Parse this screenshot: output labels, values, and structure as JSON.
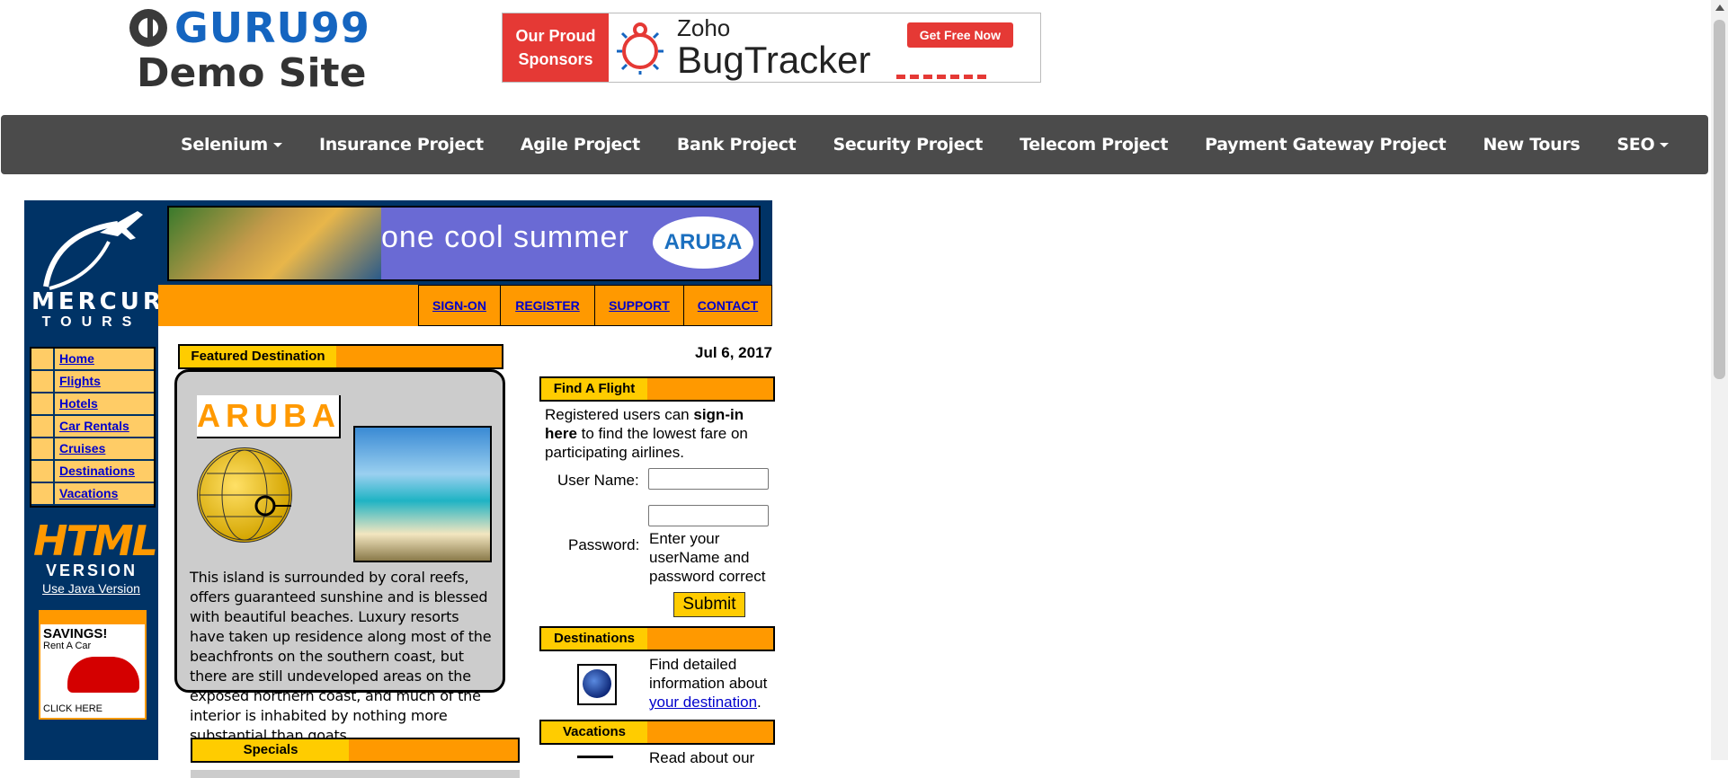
{
  "header": {
    "logo_text": "GURU99",
    "subtitle": "Demo Site",
    "sponsor": {
      "left_line1": "Our Proud",
      "left_line2": "Sponsors",
      "brand_small": "Zoho",
      "brand_big": "BugTracker",
      "cta": "Get Free Now"
    }
  },
  "navbar": {
    "items": [
      {
        "label": "Selenium",
        "dropdown": true
      },
      {
        "label": "Insurance Project",
        "dropdown": false
      },
      {
        "label": "Agile Project",
        "dropdown": false
      },
      {
        "label": "Bank Project",
        "dropdown": false
      },
      {
        "label": "Security Project",
        "dropdown": false
      },
      {
        "label": "Telecom Project",
        "dropdown": false
      },
      {
        "label": "Payment Gateway Project",
        "dropdown": false
      },
      {
        "label": "New Tours",
        "dropdown": false
      },
      {
        "label": "SEO",
        "dropdown": true
      }
    ]
  },
  "mercury": {
    "brand_word": "MERCURY",
    "brand_sub": "TOURS",
    "banner_text": "one cool summer",
    "banner_logo": "ARUBA",
    "tabs": [
      "SIGN-ON",
      "REGISTER",
      "SUPPORT",
      "CONTACT"
    ],
    "side_nav": [
      "Home",
      "Flights",
      "Hotels",
      "Car Rentals",
      "Cruises",
      "Destinations",
      "Vacations"
    ],
    "html_version": {
      "big": "HTML",
      "sub": "VERSION",
      "link": "Use Java Version"
    },
    "savings_ad": {
      "title": "SAVINGS!",
      "subtitle": "Rent A Car",
      "cta": "CLICK HERE"
    },
    "featured": {
      "title": "Featured Destination",
      "destination": "ARUBA",
      "description": "This island is surrounded by coral reefs, offers guaranteed sunshine and is blessed with beautiful beaches. Luxury resorts have taken up residence along most of the beachfronts on the southern coast, but there are still undeveloped areas on the exposed northern coast, and much of the interior is inhabited by nothing more substantial than goats."
    },
    "specials": {
      "title": "Specials"
    },
    "date": "Jul 6, 2017",
    "find_flight": {
      "title": "Find A Flight",
      "text_prefix": "Registered users can ",
      "text_bold": "sign-in here",
      "text_suffix": " to find the lowest fare on participating airlines.",
      "username_label": "User Name:",
      "username_value": "",
      "password_label": "Password:",
      "password_value": "",
      "hint": "Enter your userName and password correct",
      "submit": "Submit"
    },
    "destinations": {
      "title": "Destinations",
      "text": "Find detailed information about ",
      "link": "your destination",
      "suffix": "."
    },
    "vacations": {
      "title": "Vacations",
      "text": "Read about our"
    }
  },
  "colors": {
    "navbar": "#4b4b4b",
    "mercury_navy": "#003366",
    "mercury_orange": "#ff9900",
    "mercury_yellow": "#ffcc00",
    "link_blue": "#0000cc",
    "sponsor_red": "#e53935",
    "guru_blue": "#1565c0"
  },
  "icons": [
    "guru99-logo-icon",
    "bug-icon",
    "mercury-plane-logo",
    "globe-icon",
    "car-icon",
    "caret-down-icon"
  ]
}
